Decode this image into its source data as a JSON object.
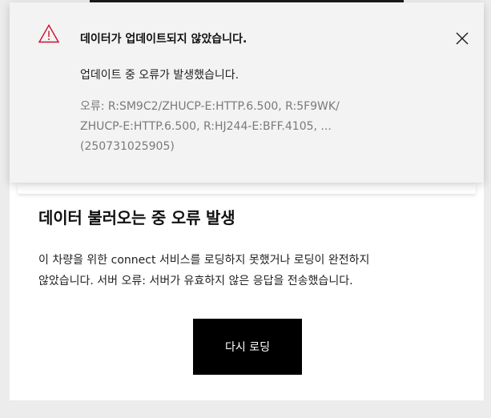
{
  "notification": {
    "title": "데이터가 업데이트되지 않았습니다.",
    "subtitle": "업데이트 중 오류가 발생했습니다.",
    "detail_lines": [
      "오류: R:SM9C2/ZHUCP-E:HTTP.6.500, R:5F9WK/",
      "ZHUCP-E:HTTP.6.500, R:HJ244-E:BFF.4105, ...",
      "(250731025905)"
    ],
    "icon": "warning-icon",
    "close_icon": "close-icon",
    "accent_color": "#c8102e"
  },
  "error_card": {
    "title": "데이터 불러오는 중 오류 발생",
    "message_lines": [
      "이 차량을 위한 connect 서비스를 로딩하지 못했거나 로딩이 완전하지",
      "않았습니다. 서버 오류: 서버가 유효하지 않은 응답을 전송했습니다."
    ],
    "reload_label": "다시 로딩"
  }
}
